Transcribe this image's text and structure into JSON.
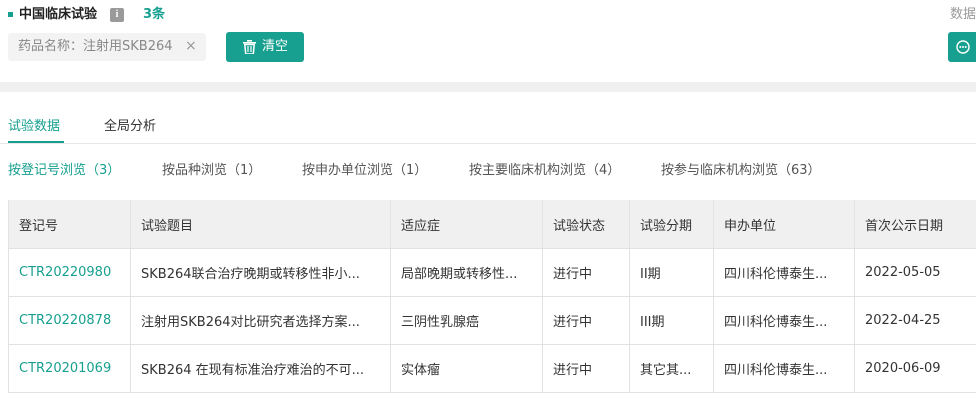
{
  "header": {
    "title": "中国临床试验",
    "info_glyph": "i",
    "count": "3条",
    "corner_text": "数据"
  },
  "filter": {
    "chip_text": "药品名称：注射用SKB264",
    "close_glyph": "×",
    "clear_label": "清空"
  },
  "tabs": [
    {
      "label": "试验数据",
      "active": true
    },
    {
      "label": "全局分析",
      "active": false
    }
  ],
  "browse_by": [
    {
      "label": "按登记号浏览（3）",
      "active": true
    },
    {
      "label": "按品种浏览（1）",
      "active": false
    },
    {
      "label": "按申办单位浏览（1）",
      "active": false
    },
    {
      "label": "按主要临床机构浏览（4）",
      "active": false
    },
    {
      "label": "按参与临床机构浏览（63）",
      "active": false
    }
  ],
  "table": {
    "columns": [
      "登记号",
      "试验题目",
      "适应症",
      "试验状态",
      "试验分期",
      "申办单位",
      "首次公示日期"
    ],
    "rows": [
      [
        "CTR20220980",
        "SKB264联合治疗晚期或转移性非小...",
        "局部晚期或转移性...",
        "进行中",
        "II期",
        "四川科伦博泰生...",
        "2022-05-05"
      ],
      [
        "CTR20220878",
        "注射用SKB264对比研究者选择方案...",
        "三阴性乳腺癌",
        "进行中",
        "III期",
        "四川科伦博泰生...",
        "2022-04-25"
      ],
      [
        "CTR20201069",
        "SKB264 在现有标准治疗难治的不可...",
        "实体瘤",
        "进行中",
        "其它其...",
        "四川科伦博泰生...",
        "2020-06-09"
      ]
    ]
  },
  "colors": {
    "accent": "#17a08f",
    "header_bg": "#f0f0f0"
  },
  "icons": {
    "info": "info-icon",
    "trash": "trash-icon",
    "more": "more-icon",
    "close": "close-icon"
  }
}
